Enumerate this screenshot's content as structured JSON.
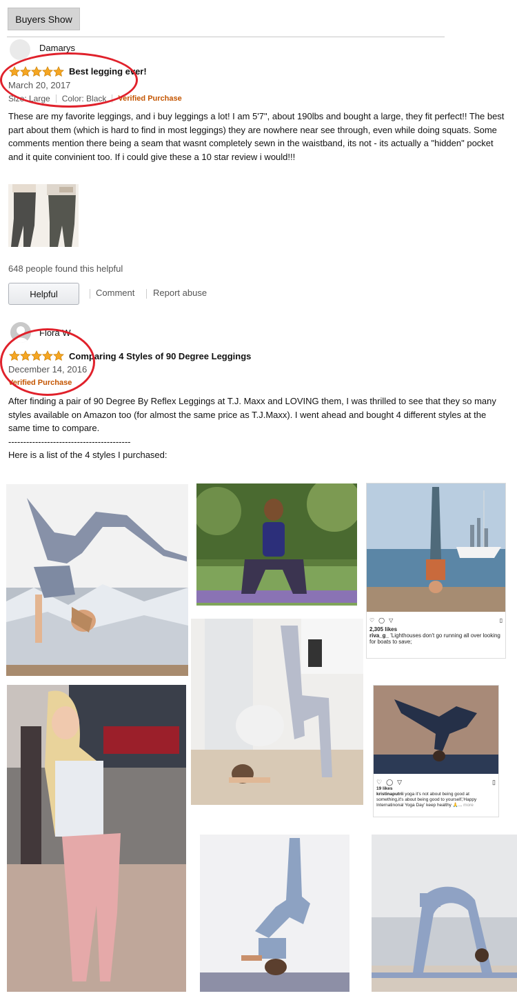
{
  "header": {
    "tab_label": "Buyers Show"
  },
  "reviews": [
    {
      "author": "Damarys",
      "rating": 5,
      "title": "Best legging ever!",
      "date": "March 20, 2017",
      "size_label": "Size: Large",
      "color_label": "Color: Black",
      "verified": "Verified Purchase",
      "body": "These are my favorite leggings, and i buy leggings a lot! I am 5'7\", about 190lbs and bought a large, they fit perfect!! The best part about them (which is hard to find in most leggings) they are nowhere near see through, even while doing squats. Some comments mention there being a seam that wasnt completely sewn in the waistband, its not - its actually a \"hidden\" pocket and it quite convinient too. If i could give these a 10 star review i would!!!",
      "helpful_count": "648 people found this helpful",
      "helpful_button": "Helpful",
      "comment_link": "Comment",
      "report_link": "Report abuse"
    },
    {
      "author": "Flora W",
      "rating": 5,
      "title": "Comparing 4 Styles of 90 Degree Leggings",
      "date": "December 14, 2016",
      "verified": "Verified Purchase",
      "body_lines": [
        "After finding a pair of 90 Degree By Reflex Leggings at T.J. Maxx and LOVING them, I was thrilled to see that they so many styles available on Amazon too (for almost the same price as T.J.Maxx). I went ahead and bought 4 different styles at the same time to compare.",
        "-----------------------------------------",
        "Here is a list of the 4 styles I purchased:"
      ]
    }
  ],
  "instagram_posts": [
    {
      "likes": "2,305 likes",
      "caption_user": "riva_g_",
      "caption": "'Lighthouses don't go running all over looking for boats to save;"
    },
    {
      "likes": "19 likes",
      "caption_user": "kristinaputrii",
      "caption": "yoga it's not about being good at something,it's about being good to yourself,'Happy Internatinonal Yoga Day' keep healthy 🙏...",
      "more": "more"
    }
  ],
  "colors": {
    "accent_circle": "#e0212b",
    "verified": "#c45500",
    "star": "#f5a623"
  }
}
